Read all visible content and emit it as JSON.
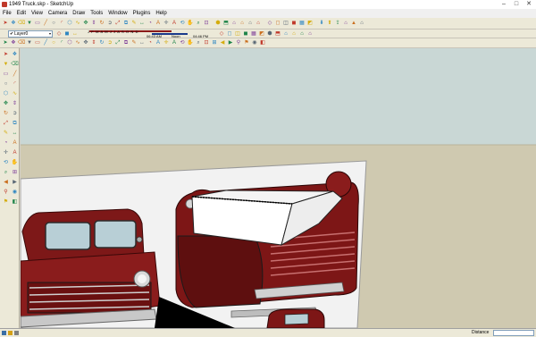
{
  "window": {
    "title": "1949 Truck.skp - SketchUp",
    "minimize": "–",
    "maximize": "□",
    "close": "✕"
  },
  "menu": [
    "File",
    "Edit",
    "View",
    "Camera",
    "Draw",
    "Tools",
    "Window",
    "Plugins",
    "Help"
  ],
  "layers": {
    "current": "Layer0",
    "visible_check": "✔",
    "dropdown": "▾"
  },
  "shadows": {
    "months": "J F M A M J J A S O N D",
    "time": "06:43 AM",
    "noon": "Noon",
    "end_time": "04:46 PM"
  },
  "status": {
    "distance_label": "Distance",
    "distance_value": ""
  },
  "colors": {
    "sky": "#c9d7d5",
    "ground": "#cfc9b0",
    "panel": "#f2f2f2",
    "truck_red": "#8a1c1c",
    "toolbar_bg": "#ece9d8",
    "date_slider": "#8b1a1a",
    "time_slider": "#1a3a8b"
  },
  "toolbar_icons": [
    "select-icon",
    "make-component-icon",
    "eraser-icon",
    "paint-icon",
    "rectangle-icon",
    "line-icon",
    "circle-icon",
    "arc-icon",
    "polygon-icon",
    "freehand-icon",
    "move-icon",
    "push-pull-icon",
    "rotate-icon",
    "follow-me-icon",
    "scale-icon",
    "offset-icon",
    "tape-measure-icon",
    "dimension-icon",
    "protractor-icon",
    "text-icon",
    "axes-icon",
    "3d-text-icon",
    "orbit-icon",
    "pan-icon",
    "zoom-icon",
    "zoom-window-icon",
    "zoom-extents-icon",
    "previous-view-icon",
    "next-view-icon",
    "position-camera-icon",
    "walk-icon",
    "look-around-icon",
    "section-plane-icon"
  ],
  "view_icons": [
    "iso-view-icon",
    "top-view-icon",
    "front-view-icon",
    "right-view-icon",
    "back-view-icon",
    "left-view-icon"
  ],
  "style_icons": [
    "xray-icon",
    "wireframe-icon",
    "hidden-line-icon",
    "shaded-icon",
    "shaded-textures-icon",
    "monochrome-icon"
  ],
  "extra_icons": [
    "get-models-icon",
    "share-model-icon",
    "share-component-icon",
    "warehouse-icon",
    "sandbox-icon",
    "house-icon"
  ],
  "left_tools": [
    "select-icon",
    "component-icon",
    "paint-bucket-icon",
    "eraser-icon",
    "rectangle-icon",
    "line-icon",
    "circle-icon",
    "arc-icon",
    "polygon-icon",
    "freehand-icon",
    "move-icon",
    "push-pull-icon",
    "rotate-icon",
    "follow-me-icon",
    "scale-icon",
    "offset-icon",
    "tape-measure-icon",
    "dimension-icon",
    "protractor-icon",
    "text-icon",
    "axes-icon",
    "3d-text-icon",
    "orbit-icon",
    "pan-icon",
    "zoom-icon",
    "zoom-extents-icon",
    "previous-icon",
    "next-icon",
    "position-camera-icon",
    "look-around-icon",
    "walk-icon",
    "section-plane-icon"
  ]
}
